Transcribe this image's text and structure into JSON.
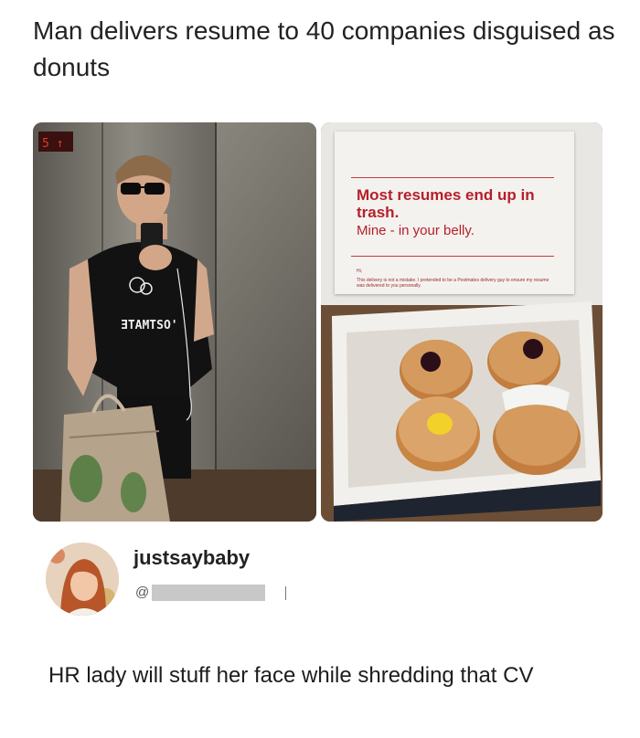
{
  "headline": "Man delivers resume to 40 companies disguised as donuts",
  "left_photo": {
    "elevator_display": "5 ↑",
    "shirt_text": "ƎTAMTSO'"
  },
  "right_photo": {
    "note_line1": "Most resumes end up in trash.",
    "note_line2": "Mine - in your belly.",
    "note_hi": "Hi,",
    "note_small": "This delivery is not a mistake. I pretended to be a Postmates delivery guy to ensure my resume was delivered to you personally."
  },
  "post": {
    "username": "justsaybaby",
    "handle_prefix": "@",
    "text": "HR lady will stuff her face while shredding that CV"
  },
  "colors": {
    "note_red": "#b51f2a",
    "background": "#ffffff"
  }
}
